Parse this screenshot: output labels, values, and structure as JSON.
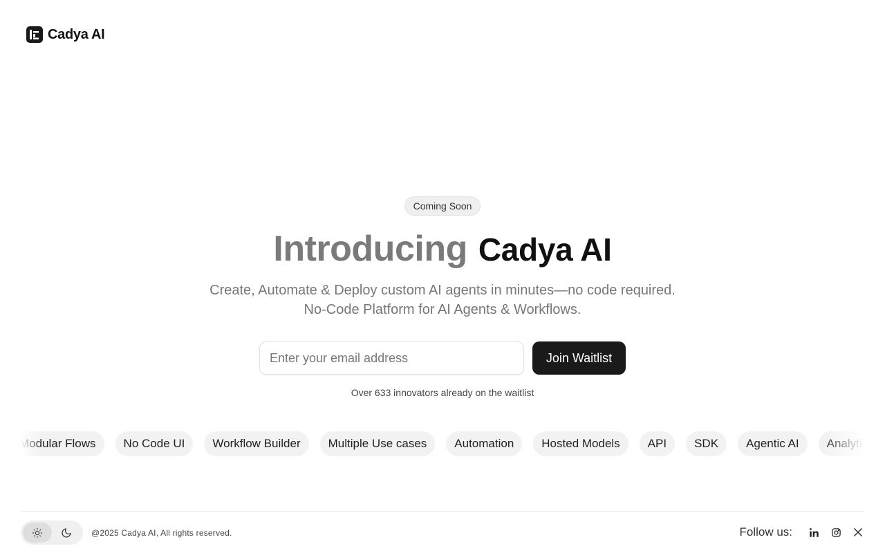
{
  "brand": {
    "name": "Cadya AI"
  },
  "hero": {
    "badge": "Coming Soon",
    "headline_intro": "Introducing",
    "headline_brand": "Cadya AI",
    "subtitle_line1": "Create, Automate & Deploy custom AI agents in minutes—no code required.",
    "subtitle_line2": "No-Code Platform for AI Agents & Workflows."
  },
  "waitlist": {
    "email_placeholder": "Enter your email address",
    "email_value": "",
    "button_label": "Join Waitlist",
    "count_text": "Over 633 innovators already on the waitlist"
  },
  "features": [
    "Modular Flows",
    "No Code UI",
    "Workflow Builder",
    "Multiple Use cases",
    "Automation",
    "Hosted Models",
    "API",
    "SDK",
    "Agentic AI",
    "Analytics"
  ],
  "footer": {
    "theme_options": [
      {
        "icon": "sun-icon",
        "active": true
      },
      {
        "icon": "moon-icon",
        "active": false
      }
    ],
    "copyright": "@2025 Cadya AI, All rights reserved.",
    "follow_label": "Follow us:",
    "social_icons": [
      "linkedin-icon",
      "instagram-icon",
      "x-icon"
    ]
  },
  "colors": {
    "primary": "#1a1a1a",
    "muted_text": "#777777",
    "pill_bg": "#f2f2f2"
  }
}
